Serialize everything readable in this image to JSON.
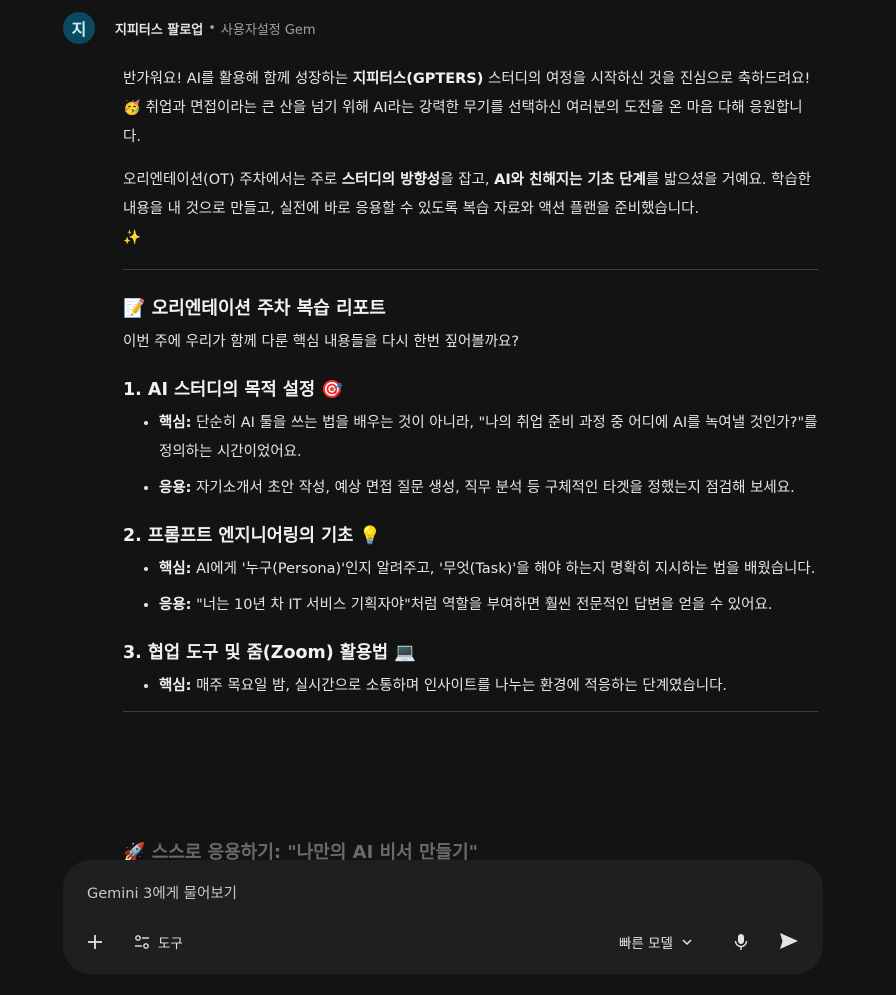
{
  "header": {
    "avatar_letter": "지",
    "gem_name": "지피터스 팔로업",
    "separator": "•",
    "gem_type": "사용자설정 Gem"
  },
  "message": {
    "intro_1": "반가워요! AI를 활용해 함께 성장하는 ",
    "intro_bold": "지피터스(GPTERS)",
    "intro_2": " 스터디의 여정을 시작하신 것을 진심으로 축하드려요! ",
    "intro_emoji": "🥳",
    "intro_3": " 취업과 면접이라는 큰 산을 넘기 위해 AI라는 강력한 무기를 선택하신 여러분의 도전을 온 마음 다해 응원합니다.",
    "p2_1": "오리엔테이션(OT) 주차에서는 주로 ",
    "p2_bold1": "스터디의 방향성",
    "p2_2": "을 잡고, ",
    "p2_bold2": "AI와 친해지는 기초 단계",
    "p2_3": "를 밟으셨을 거예요. 학습한 내용을 내 것으로 만들고, 실전에 바로 응용할 수 있도록 복습 자료와 액션 플랜을 준비했습니다.",
    "p2_emoji": "✨",
    "report_emoji": "📝",
    "report_title": "오리엔테이션 주차 복습 리포트",
    "report_sub": "이번 주에 우리가 함께 다룬 핵심 내용들을 다시 한번 짚어볼까요?",
    "sections": [
      {
        "title": "1. AI 스터디의 목적 설정",
        "emoji": "🎯",
        "items": [
          {
            "label": "핵심:",
            "text": " 단순히 AI 툴을 쓰는 법을 배우는 것이 아니라, \"나의 취업 준비 과정 중 어디에 AI를 녹여낼 것인가?\"를 정의하는 시간이었어요."
          },
          {
            "label": "응용:",
            "text": " 자기소개서 초안 작성, 예상 면접 질문 생성, 직무 분석 등 구체적인 타겟을 정했는지 점검해 보세요."
          }
        ]
      },
      {
        "title": "2. 프롬프트 엔지니어링의 기초",
        "emoji": "💡",
        "items": [
          {
            "label": "핵심:",
            "text": " AI에게 '누구(Persona)'인지 알려주고, '무엇(Task)'을 해야 하는지 명확히 지시하는 법을 배웠습니다."
          },
          {
            "label": "응용:",
            "text": " \"너는 10년 차 IT 서비스 기획자야\"처럼 역할을 부여하면 훨씬 전문적인 답변을 얻을 수 있어요."
          }
        ]
      },
      {
        "title": "3. 협업 도구 및 줌(Zoom) 활용법",
        "emoji": "💻",
        "items": [
          {
            "label": "핵심:",
            "text": " 매주 목요일 밤, 실시간으로 소통하며 인사이트를 나누는 환경에 적응하는 단계였습니다."
          }
        ]
      }
    ],
    "next_heading_emoji": "🚀",
    "next_heading": "스스로 응용하기: \"나만의 AI 비서 만들기\""
  },
  "input": {
    "placeholder": "Gemini 3에게 물어보기",
    "tools_label": "도구",
    "model_label": "빠른 모델"
  },
  "icons": {
    "add": "plus-icon",
    "tools": "tools-icon",
    "model_dropdown": "chevron-down-icon",
    "mic": "microphone-icon",
    "send": "send-icon"
  }
}
